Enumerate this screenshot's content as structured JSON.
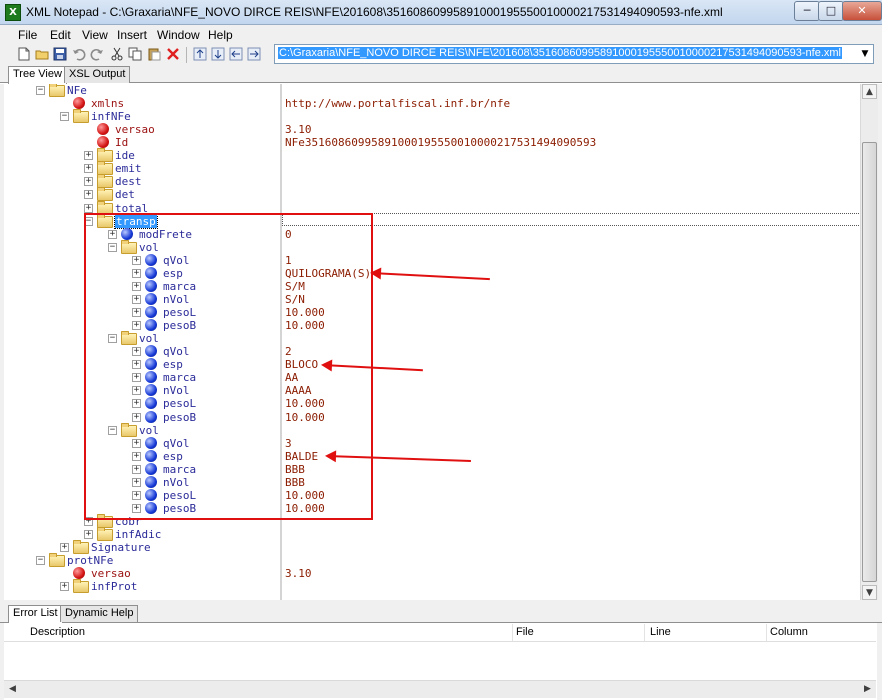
{
  "window": {
    "title": "XML Notepad - C:\\Graxaria\\NFE_NOVO DIRCE REIS\\NFE\\201608\\35160860995891000195550010000217531494090593-nfe.xml",
    "app_icon": "xml-notepad-icon",
    "minimize": "─",
    "maximize": "□",
    "close": "✕"
  },
  "menu": [
    "File",
    "Edit",
    "View",
    "Insert",
    "Window",
    "Help"
  ],
  "toolbar": {
    "icons": [
      "new-file-icon",
      "open-folder-icon",
      "save-icon",
      "undo-icon",
      "redo-icon",
      "cut-icon",
      "copy-icon",
      "paste-icon",
      "delete-icon",
      "nudge-up-icon",
      "nudge-down-icon",
      "nudge-left-icon",
      "nudge-right-icon"
    ],
    "path": "C:\\Graxaria\\NFE_NOVO DIRCE REIS\\NFE\\201608\\35160860995891000195550010000217531494090593-nfe.xml"
  },
  "tabs": {
    "tree_view": "Tree View",
    "xsl_output": "XSL Output"
  },
  "tree": [
    {
      "label": "NFe",
      "kind": "element",
      "depth": 1,
      "expander": "-",
      "value": ""
    },
    {
      "label": "xmlns",
      "kind": "attribute",
      "depth": 2,
      "expander": "",
      "value": "http://www.portalfiscal.inf.br/nfe"
    },
    {
      "label": "infNFe",
      "kind": "element",
      "depth": 2,
      "expander": "-",
      "value": ""
    },
    {
      "label": "versao",
      "kind": "attribute",
      "depth": 3,
      "expander": "",
      "value": "3.10"
    },
    {
      "label": "Id",
      "kind": "attribute",
      "depth": 3,
      "expander": "",
      "value": "NFe35160860995891000195550010000217531494090593"
    },
    {
      "label": "ide",
      "kind": "element",
      "depth": 3,
      "expander": "+",
      "value": ""
    },
    {
      "label": "emit",
      "kind": "element",
      "depth": 3,
      "expander": "+",
      "value": ""
    },
    {
      "label": "dest",
      "kind": "element",
      "depth": 3,
      "expander": "+",
      "value": ""
    },
    {
      "label": "det",
      "kind": "element",
      "depth": 3,
      "expander": "+",
      "value": ""
    },
    {
      "label": "total",
      "kind": "element",
      "depth": 3,
      "expander": "+",
      "value": ""
    },
    {
      "label": "transp",
      "kind": "element",
      "depth": 3,
      "expander": "-",
      "value": "",
      "selected": true
    },
    {
      "label": "modFrete",
      "kind": "text",
      "depth": 4,
      "expander": "+",
      "value": "0"
    },
    {
      "label": "vol",
      "kind": "element",
      "depth": 4,
      "expander": "-",
      "value": ""
    },
    {
      "label": "qVol",
      "kind": "text",
      "depth": 5,
      "expander": "+",
      "value": "1"
    },
    {
      "label": "esp",
      "kind": "text",
      "depth": 5,
      "expander": "+",
      "value": "QUILOGRAMA(S)"
    },
    {
      "label": "marca",
      "kind": "text",
      "depth": 5,
      "expander": "+",
      "value": "S/M"
    },
    {
      "label": "nVol",
      "kind": "text",
      "depth": 5,
      "expander": "+",
      "value": "S/N"
    },
    {
      "label": "pesoL",
      "kind": "text",
      "depth": 5,
      "expander": "+",
      "value": "10.000"
    },
    {
      "label": "pesoB",
      "kind": "text",
      "depth": 5,
      "expander": "+",
      "value": "10.000"
    },
    {
      "label": "vol",
      "kind": "element",
      "depth": 4,
      "expander": "-",
      "value": ""
    },
    {
      "label": "qVol",
      "kind": "text",
      "depth": 5,
      "expander": "+",
      "value": "2"
    },
    {
      "label": "esp",
      "kind": "text",
      "depth": 5,
      "expander": "+",
      "value": "BLOCO"
    },
    {
      "label": "marca",
      "kind": "text",
      "depth": 5,
      "expander": "+",
      "value": "AA"
    },
    {
      "label": "nVol",
      "kind": "text",
      "depth": 5,
      "expander": "+",
      "value": "AAAA"
    },
    {
      "label": "pesoL",
      "kind": "text",
      "depth": 5,
      "expander": "+",
      "value": "10.000"
    },
    {
      "label": "pesoB",
      "kind": "text",
      "depth": 5,
      "expander": "+",
      "value": "10.000"
    },
    {
      "label": "vol",
      "kind": "element",
      "depth": 4,
      "expander": "-",
      "value": ""
    },
    {
      "label": "qVol",
      "kind": "text",
      "depth": 5,
      "expander": "+",
      "value": "3"
    },
    {
      "label": "esp",
      "kind": "text",
      "depth": 5,
      "expander": "+",
      "value": "BALDE"
    },
    {
      "label": "marca",
      "kind": "text",
      "depth": 5,
      "expander": "+",
      "value": "BBB"
    },
    {
      "label": "nVol",
      "kind": "text",
      "depth": 5,
      "expander": "+",
      "value": "BBB"
    },
    {
      "label": "pesoL",
      "kind": "text",
      "depth": 5,
      "expander": "+",
      "value": "10.000"
    },
    {
      "label": "pesoB",
      "kind": "text",
      "depth": 5,
      "expander": "+",
      "value": "10.000"
    },
    {
      "label": "cobr",
      "kind": "element",
      "depth": 3,
      "expander": "+",
      "value": ""
    },
    {
      "label": "infAdic",
      "kind": "element",
      "depth": 3,
      "expander": "+",
      "value": ""
    },
    {
      "label": "Signature",
      "kind": "element",
      "depth": 2,
      "expander": "+",
      "value": ""
    },
    {
      "label": "protNFe",
      "kind": "element",
      "depth": 1,
      "expander": "-",
      "value": ""
    },
    {
      "label": "versao",
      "kind": "attribute",
      "depth": 2,
      "expander": "",
      "value": "3.10"
    },
    {
      "label": "infProt",
      "kind": "element",
      "depth": 2,
      "expander": "+",
      "value": ""
    }
  ],
  "bottom_tabs": {
    "error_list": "Error List",
    "dynamic_help": "Dynamic Help"
  },
  "error_columns": {
    "description": "Description",
    "file": "File",
    "line": "Line",
    "column": "Column"
  },
  "scrollbar": {
    "up": "▲",
    "down": "▼",
    "left": "◀",
    "right": "▶"
  },
  "colors": {
    "element_text": "#2b2b99",
    "attribute_text": "#9b1010",
    "value_text": "#8b1c00",
    "selection": "#3399ff",
    "annotation": "#e01010"
  }
}
